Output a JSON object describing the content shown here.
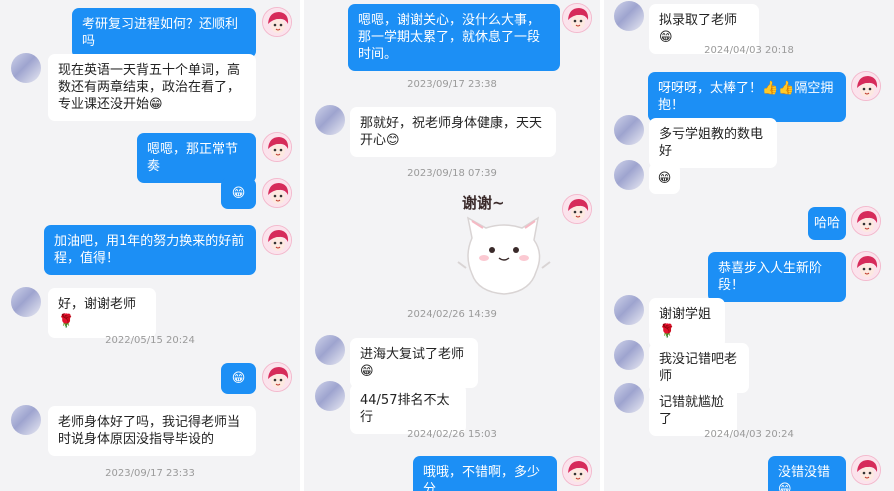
{
  "panel1": {
    "messages": [
      {
        "text": "考研复习进程如何？还顺利吗"
      },
      {
        "text": "现在英语一天背五十个单词，高数还有两章结束，政治在看了，专业课还没开始😁"
      },
      {
        "text": "嗯嗯，那正常节奏"
      },
      {
        "text": "😁"
      },
      {
        "text": "加油吧，用1年的努力换来的好前程，值得！"
      },
      {
        "text": "好，谢谢老师🌹"
      },
      {
        "text": "😁"
      },
      {
        "text": "老师身体好了吗，我记得老师当时说身体原因没指导毕设的"
      }
    ],
    "timestamps": [
      "2022/05/15 20:24",
      "2023/09/17 23:33"
    ]
  },
  "panel2": {
    "messages": [
      {
        "text": "嗯嗯，谢谢关心，没什么大事，那一学期太累了，就休息了一段时间。"
      },
      {
        "text": "那就好，祝老师身体健康，天天开心😊"
      },
      {
        "text": "进海大复试了老师😁"
      },
      {
        "text": "44/57排名不太行"
      },
      {
        "text": "哦哦，不错啊，多少分"
      }
    ],
    "timestamps": [
      "2023/09/17 23:38",
      "2023/09/18 07:39",
      "2024/02/26 14:39",
      "2024/02/26 15:03"
    ],
    "sticker_text": "谢谢~"
  },
  "panel3": {
    "messages": [
      {
        "text": "拟录取了老师😁"
      },
      {
        "text": "呀呀呀，太棒了！👍👍隔空拥抱！"
      },
      {
        "text": "多亏学姐教的数电好"
      },
      {
        "text": "😁"
      },
      {
        "text": "哈哈"
      },
      {
        "text": "恭喜步入人生新阶段！"
      },
      {
        "text": "谢谢学姐🌹"
      },
      {
        "text": "我没记错吧老师"
      },
      {
        "text": "记错就尴尬了"
      },
      {
        "text": "没错没错😁"
      }
    ],
    "timestamps": [
      "2024/04/03 20:18",
      "2024/04/03 20:24"
    ]
  },
  "colors": {
    "outgoing": "#1c8ff5",
    "incoming": "#ffffff",
    "background": "#f3f3f5"
  }
}
